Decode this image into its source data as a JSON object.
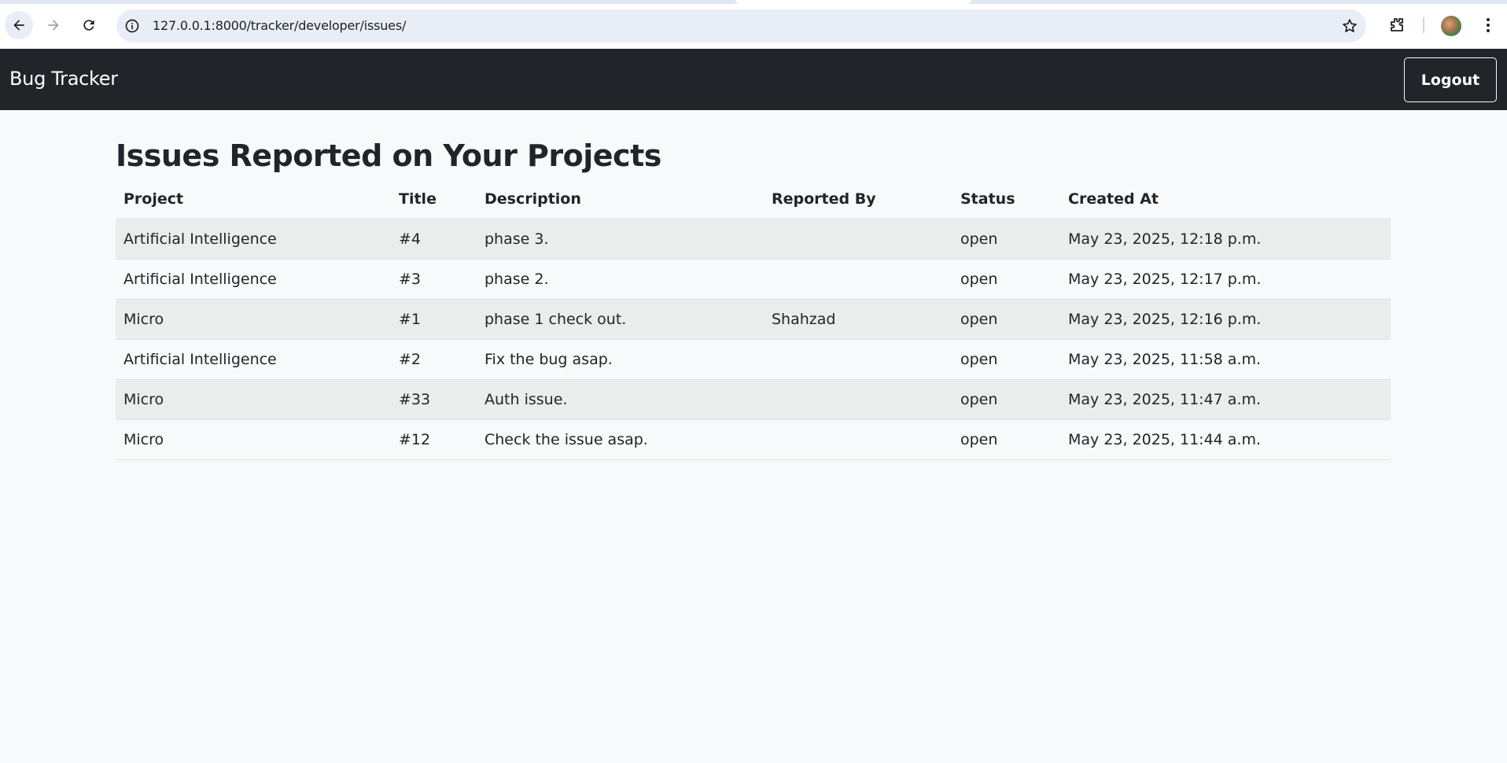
{
  "browser": {
    "url": "127.0.0.1:8000/tracker/developer/issues/"
  },
  "navbar": {
    "brand": "Bug Tracker",
    "logout_label": "Logout"
  },
  "main": {
    "title": "Issues Reported on Your Projects",
    "table": {
      "headers": [
        "Project",
        "Title",
        "Description",
        "Reported By",
        "Status",
        "Created At"
      ],
      "rows": [
        {
          "project": "Artificial Intelligence",
          "title": "#4",
          "description": "phase 3.",
          "reported_by": "",
          "status": "open",
          "created_at": "May 23, 2025, 12:18 p.m."
        },
        {
          "project": "Artificial Intelligence",
          "title": "#3",
          "description": "phase 2.",
          "reported_by": "",
          "status": "open",
          "created_at": "May 23, 2025, 12:17 p.m."
        },
        {
          "project": "Micro",
          "title": "#1",
          "description": "phase 1 check out.",
          "reported_by": "Shahzad",
          "status": "open",
          "created_at": "May 23, 2025, 12:16 p.m."
        },
        {
          "project": "Artificial Intelligence",
          "title": "#2",
          "description": "Fix the bug asap.",
          "reported_by": "",
          "status": "open",
          "created_at": "May 23, 2025, 11:58 a.m."
        },
        {
          "project": "Micro",
          "title": "#33",
          "description": "Auth issue.",
          "reported_by": "",
          "status": "open",
          "created_at": "May 23, 2025, 11:47 a.m."
        },
        {
          "project": "Micro",
          "title": "#12",
          "description": "Check the issue asap.",
          "reported_by": "",
          "status": "open",
          "created_at": "May 23, 2025, 11:44 a.m."
        }
      ]
    }
  },
  "icons": {
    "back": "arrow-left-icon",
    "forward": "arrow-right-icon",
    "reload": "reload-icon",
    "info": "info-icon",
    "bookmark": "star-icon",
    "extensions": "puzzle-icon",
    "menu": "kebab-menu-icon"
  },
  "colors": {
    "navbar_bg": "#212529",
    "page_bg": "#f8f9fa",
    "striped_row": "#ebecec"
  }
}
